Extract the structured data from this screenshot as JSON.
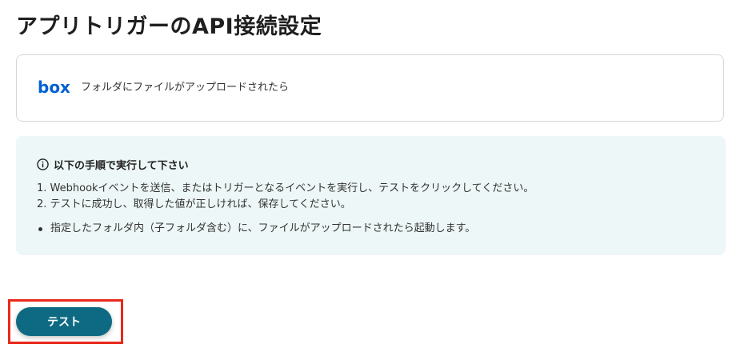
{
  "page": {
    "title": "アプリトリガーのAPI接続設定"
  },
  "trigger": {
    "app_icon": "box-logo",
    "label": "フォルダにファイルがアップロードされたら"
  },
  "instructions": {
    "icon": "info-icon",
    "heading": "以下の手順で実行して下さい",
    "steps": [
      "1. Webhookイベントを送信、またはトリガーとなるイベントを実行し、テストをクリックしてください。",
      "2. テストに成功し、取得した値が正しければ、保存してください。"
    ],
    "notes": [
      "指定したフォルダ内（子フォルダ含む）に、ファイルがアップロードされたら起動します。"
    ]
  },
  "actions": {
    "test_label": "テスト"
  },
  "colors": {
    "accent": "#0d6a82",
    "box_brand": "#0061d5",
    "panel_bg": "#eef7f7",
    "highlight": "#e8291c"
  }
}
